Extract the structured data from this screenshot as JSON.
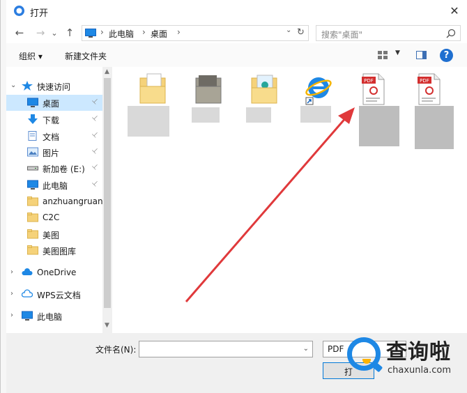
{
  "window": {
    "title": "打开",
    "close_glyph": "✕"
  },
  "nav": {
    "back_glyph": "←",
    "forward_glyph": "→",
    "recent_glyph": "⌄",
    "up_glyph": "↑",
    "breadcrumb": [
      "此电脑",
      "桌面"
    ],
    "crumb_sep": "›",
    "addr_dropdown_glyph": "⌄",
    "refresh_glyph": "↻",
    "search_placeholder": "搜索\"桌面\""
  },
  "toolbar": {
    "organize_label": "组织 ▾",
    "new_folder_label": "新建文件夹",
    "view_dropdown_glyph": "▼",
    "help_glyph": "?"
  },
  "sidebar": {
    "items": [
      {
        "label": "快速访问",
        "icon": "star-icon",
        "pinned": false,
        "expander": "⌄"
      },
      {
        "label": "桌面",
        "icon": "desktop-icon",
        "pinned": true,
        "selected": true
      },
      {
        "label": "下载",
        "icon": "download-icon",
        "pinned": true
      },
      {
        "label": "文档",
        "icon": "document-icon",
        "pinned": true
      },
      {
        "label": "图片",
        "icon": "picture-icon",
        "pinned": true
      },
      {
        "label": "新加卷 (E:)",
        "icon": "drive-icon",
        "pinned": true
      },
      {
        "label": "此电脑",
        "icon": "computer-icon",
        "pinned": true
      },
      {
        "label": "anzhuangruanj",
        "icon": "folder-icon",
        "pinned": false
      },
      {
        "label": "C2C",
        "icon": "folder-icon",
        "pinned": false
      },
      {
        "label": "美图",
        "icon": "folder-icon",
        "pinned": false
      },
      {
        "label": "美图图库",
        "icon": "folder-icon",
        "pinned": false
      },
      {
        "label": "OneDrive",
        "icon": "cloud-icon",
        "pinned": false,
        "expander": "›"
      },
      {
        "label": "WPS云文档",
        "icon": "cloud-outline-icon",
        "pinned": false,
        "expander": "›"
      },
      {
        "label": "此电脑",
        "icon": "computer-icon",
        "pinned": false,
        "expander": "›"
      }
    ],
    "pin_glyph": "📌",
    "scroll_up_glyph": "▲",
    "scroll_down_glyph": "▼"
  },
  "files": [
    {
      "icon": "folder-doc-icon",
      "label": ""
    },
    {
      "icon": "folder-dark-icon",
      "label": ""
    },
    {
      "icon": "folder-image-icon",
      "label": ""
    },
    {
      "icon": "ie-shortcut-icon",
      "label": ""
    },
    {
      "icon": "pdf-icon",
      "label": ""
    },
    {
      "icon": "pdf-icon",
      "label": ""
    }
  ],
  "pdf_badge": "PDF",
  "bottom": {
    "filename_label": "文件名(N):",
    "filename_value": "",
    "filename_dropdown_glyph": "⌄",
    "filetype_value": "PDF",
    "open_button_label": "打"
  },
  "watermark": {
    "text": "查询啦",
    "url": "chaxunla.com"
  },
  "colors": {
    "accent": "#0078d7",
    "selection": "#cce8ff",
    "arrow": "#e0393b",
    "help": "#1f6fd0"
  }
}
